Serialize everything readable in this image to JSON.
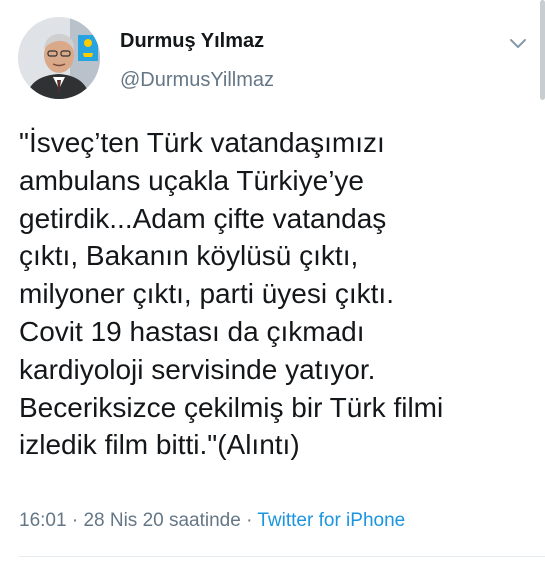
{
  "author": {
    "name": "Durmuş Yılmaz",
    "handle": "@DurmusYillmaz"
  },
  "tweet": {
    "lines": [
      "\"İsveç’ten Türk vatandaşımızı",
      "ambulans uçakla Türkiye’ye",
      "getirdik...Adam çifte vatandaş",
      "çıktı, Bakanın köylüsü çıktı,",
      "milyoner çıktı, parti üyesi çıktı.",
      "Covit 19 hastası da çıkmadı",
      "kardiyoloji servisinde yatıyor.",
      "Beceriksizce çekilmiş bir Türk filmi",
      "izledik film bitti.\"(Alıntı)"
    ]
  },
  "meta": {
    "time": "16:01",
    "separator": " · ",
    "date": "28 Nis 20 saatinde",
    "separator2": " · ",
    "source": "Twitter for iPhone"
  },
  "colors": {
    "text": "#14171a",
    "secondary": "#657786",
    "link": "#1b95e0",
    "badge": "#ffcc00"
  },
  "icons": {
    "menu": "chevron-down-icon",
    "avatar": "profile-photo"
  }
}
